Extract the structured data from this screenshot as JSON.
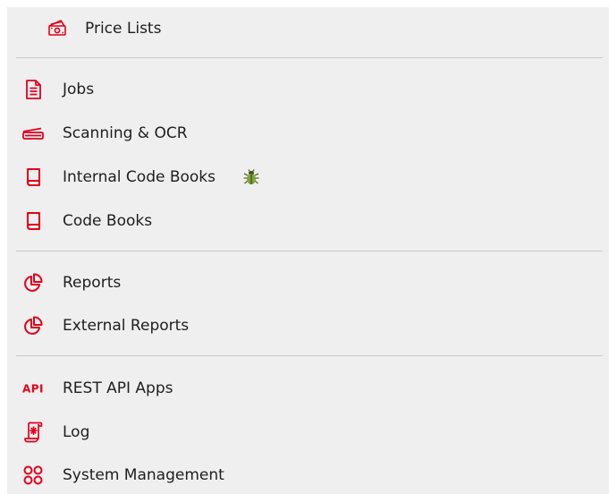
{
  "menu": {
    "accent_color": "#e3001b",
    "items": [
      {
        "label": "Price Lists",
        "icon": "money-icon"
      },
      {
        "label": "Jobs",
        "icon": "document-icon"
      },
      {
        "label": "Scanning & OCR",
        "icon": "scanner-icon"
      },
      {
        "label": "Internal Code Books",
        "icon": "book-icon",
        "badge_icon": "bug-icon"
      },
      {
        "label": "Code Books",
        "icon": "book-icon"
      },
      {
        "label": "Reports",
        "icon": "pie-chart-icon"
      },
      {
        "label": "External Reports",
        "icon": "pie-chart-icon"
      },
      {
        "label": "REST API Apps",
        "icon": "api-icon",
        "icon_text": "API"
      },
      {
        "label": "Log",
        "icon": "log-scroll-icon"
      },
      {
        "label": "System Management",
        "icon": "grid-apps-icon"
      }
    ]
  }
}
